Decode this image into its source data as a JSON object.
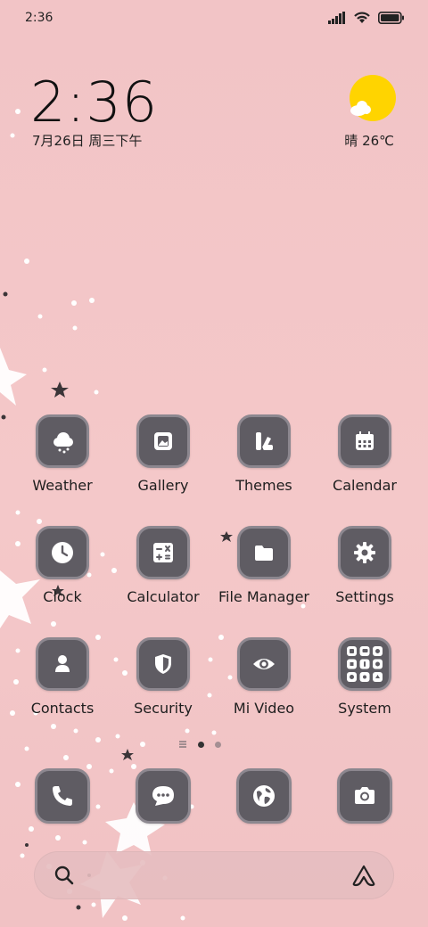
{
  "status": {
    "time": "2:36"
  },
  "lock": {
    "time": "2:36",
    "date": "7月26日 周三下午"
  },
  "weather": {
    "text": "晴 26℃",
    "icon": "sun-cloud-icon"
  },
  "apps": [
    {
      "label": "Weather",
      "icon": "weather-icon"
    },
    {
      "label": "Gallery",
      "icon": "gallery-icon"
    },
    {
      "label": "Themes",
      "icon": "themes-icon"
    },
    {
      "label": "Calendar",
      "icon": "calendar-icon"
    },
    {
      "label": "Clock",
      "icon": "clock-icon"
    },
    {
      "label": "Calculator",
      "icon": "calculator-icon"
    },
    {
      "label": "File Manager",
      "icon": "folder-icon"
    },
    {
      "label": "Settings",
      "icon": "gear-icon"
    },
    {
      "label": "Contacts",
      "icon": "contacts-icon"
    },
    {
      "label": "Security",
      "icon": "shield-icon"
    },
    {
      "label": "Mi Video",
      "icon": "eye-icon"
    },
    {
      "label": "System",
      "icon": "folder-grid-icon"
    }
  ],
  "dock": [
    {
      "icon": "phone-icon"
    },
    {
      "icon": "messages-icon"
    },
    {
      "icon": "browser-globe-icon"
    },
    {
      "icon": "camera-icon"
    }
  ],
  "colors": {
    "wallpaper": "#f3c5c7",
    "tile": "#5f5c63",
    "tile_border": "#8c878f",
    "weather_sun": "#ffd400"
  }
}
